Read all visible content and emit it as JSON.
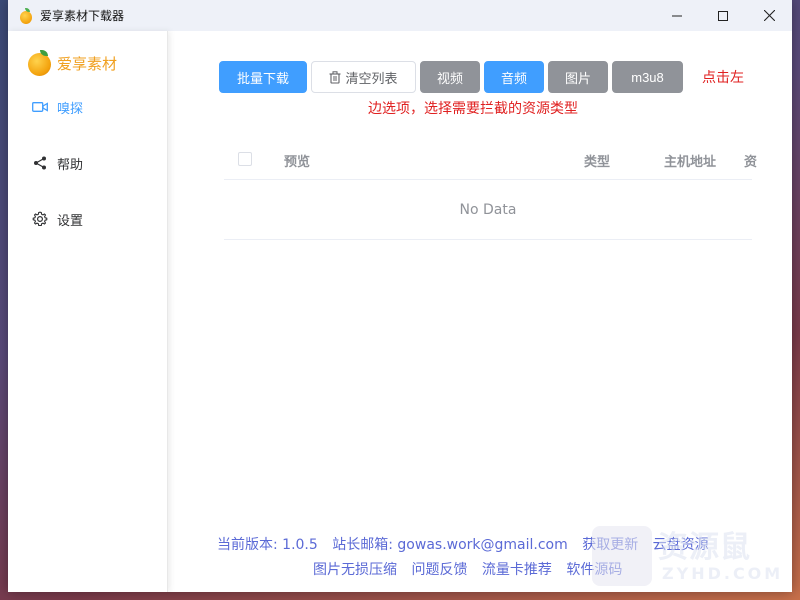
{
  "window": {
    "title": "爱享素材下载器",
    "controls": {
      "minimize": "—",
      "maximize": "☐",
      "close": "✕"
    }
  },
  "sidebar": {
    "brand": "爱享素材",
    "items": [
      {
        "label": "嗅探",
        "icon": "video-camera-icon",
        "active": true
      },
      {
        "label": "帮助",
        "icon": "share-icon",
        "active": false
      },
      {
        "label": "设置",
        "icon": "gear-icon",
        "active": false
      }
    ]
  },
  "toolbar": {
    "batch_download": "批量下载",
    "clear_list": "清空列表",
    "video": "视频",
    "audio": "音频",
    "image": "图片",
    "m3u8": "m3u8"
  },
  "hint": {
    "part1": "点击左",
    "part2": "边选项，选择需要拦截的资源类型"
  },
  "table": {
    "columns": [
      "预览",
      "类型",
      "主机地址",
      "资"
    ],
    "empty_text": "No Data"
  },
  "footer": {
    "version": "当前版本: 1.0.5",
    "email": "站长邮箱: gowas.work@gmail.com",
    "links_line1": [
      "获取更新",
      "云盘资源"
    ],
    "links_line2": [
      "图片无损压缩",
      "问题反馈",
      "流量卡推荐",
      "软件源码"
    ]
  },
  "colors": {
    "primary": "#409eff",
    "gray_button": "#909399",
    "hint_red": "#e02020",
    "footer_link": "#5b6ad6",
    "brand_orange": "#f0a020"
  },
  "watermark": {
    "text": "资源鼠",
    "sub": "ZYHD.COM"
  }
}
